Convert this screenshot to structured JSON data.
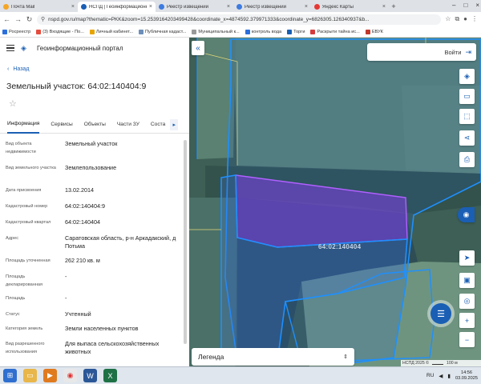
{
  "browser": {
    "tabs": [
      {
        "title": "Почта Mail",
        "icon_color": "#f5a623",
        "active": false
      },
      {
        "title": "НСПД | Геоинформационный",
        "icon_color": "#1a5fb4",
        "active": true
      },
      {
        "title": "Реестр извещений",
        "icon_color": "#3d7be0",
        "active": false
      },
      {
        "title": "Реестр извещений",
        "icon_color": "#3d7be0",
        "active": false
      },
      {
        "title": "Яндекс Карты",
        "icon_color": "#e53935",
        "active": false
      }
    ],
    "url": "nspd.gov.ru/map?thematic=PKK&zoom=15.2539164203499428&coordinate_x=4874592.379971333&coordinate_y=6826305.126340937&b...",
    "bookmarks": [
      {
        "label": "Росреестр",
        "color": "#2a6fdb"
      },
      {
        "label": "(3) Входящие - По...",
        "color": "#e44c3c"
      },
      {
        "label": "Личный кабинет...",
        "color": "#e6a400"
      },
      {
        "label": "Публичная кадаст...",
        "color": "#6d8fb8"
      },
      {
        "label": "Муниципальный к...",
        "color": "#999999"
      },
      {
        "label": "контроль вода",
        "color": "#2a6fdb"
      },
      {
        "label": "Торги",
        "color": "#1a5fb4"
      },
      {
        "label": "Раскрыти тайна ис...",
        "color": "#d63b3b"
      },
      {
        "label": "ЕВУК",
        "color": "#c0392b"
      }
    ]
  },
  "panel": {
    "portal_title": "Геоинформационный портал",
    "back_label": "Назад",
    "title": "Земельный участок: 64:02:140404:9",
    "tabs": [
      "Информация",
      "Сервисы",
      "Объекты",
      "Части ЗУ",
      "Соста"
    ],
    "rows": [
      {
        "label": "Вид объекта недвижимости",
        "value": "Земельный участок"
      },
      {
        "label": "Вид земельного участка",
        "value": "Землепользование"
      },
      {
        "label": "Дата присвоения",
        "value": "13.02.2014"
      },
      {
        "label": "Кадастровый номер",
        "value": "64:02:140404:9"
      },
      {
        "label": "Кадастровый квартал",
        "value": "64:02:140404"
      },
      {
        "label": "Адрес",
        "value": "Саратовская область, р-н Аркадакский, д Потьма"
      },
      {
        "label": "Площадь уточненная",
        "value": "262 210 кв. м"
      },
      {
        "label": "Площадь декларированная",
        "value": "-"
      },
      {
        "label": "Площадь",
        "value": "-"
      },
      {
        "label": "Статус",
        "value": "Учтенный"
      },
      {
        "label": "Категория земель",
        "value": "Земли населенных пунктов"
      },
      {
        "label": "Вид разрешенного использования",
        "value": "Для выпаса сельскохозяйственных животных"
      }
    ]
  },
  "map": {
    "login_label": "Войти",
    "parcel_label": "64:02:140404",
    "legend_label": "Легенда",
    "attribution": "НСПД 2025 ©",
    "scale_label": "100 м"
  },
  "taskbar": {
    "lang": "RU",
    "time": "14:56",
    "date": "03.09.2025"
  }
}
